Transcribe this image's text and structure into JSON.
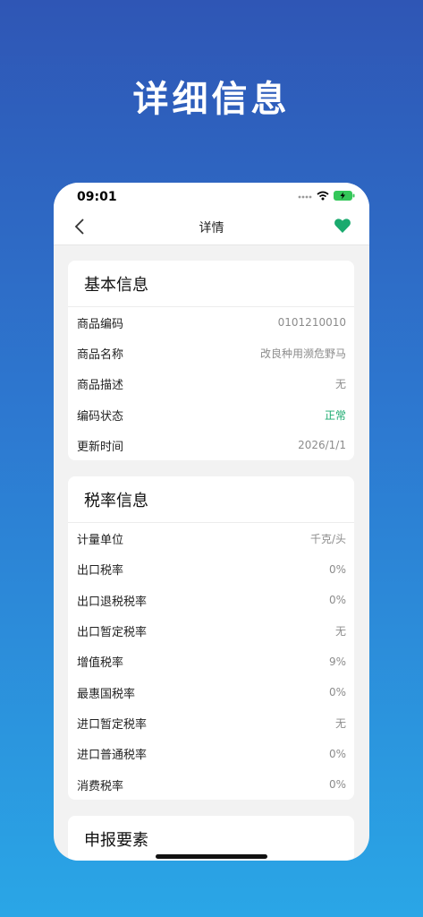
{
  "hero": {
    "title": "详细信息"
  },
  "status_bar": {
    "time": "09:01"
  },
  "nav": {
    "title": "详情",
    "back_icon": "chevron-left-icon",
    "favorite_icon": "heart-icon",
    "accent": "#1aaa6e"
  },
  "basic_info": {
    "title": "基本信息",
    "rows": [
      {
        "label": "商品编码",
        "value": "0101210010"
      },
      {
        "label": "商品名称",
        "value": "改良种用濒危野马"
      },
      {
        "label": "商品描述",
        "value": "无"
      },
      {
        "label": "编码状态",
        "value": "正常"
      },
      {
        "label": "更新时间",
        "value": "2026/1/1"
      }
    ]
  },
  "tax_info": {
    "title": "税率信息",
    "rows": [
      {
        "label": "计量单位",
        "value": "千克/头"
      },
      {
        "label": "出口税率",
        "value": "0%"
      },
      {
        "label": "出口退税税率",
        "value": "0%"
      },
      {
        "label": "出口暂定税率",
        "value": "无"
      },
      {
        "label": "增值税率",
        "value": "9%"
      },
      {
        "label": "最惠国税率",
        "value": "0%"
      },
      {
        "label": "进口暂定税率",
        "value": "无"
      },
      {
        "label": "进口普通税率",
        "value": "0%"
      },
      {
        "label": "消费税率",
        "value": "0%"
      }
    ]
  },
  "declaration": {
    "title": "申报要素"
  }
}
